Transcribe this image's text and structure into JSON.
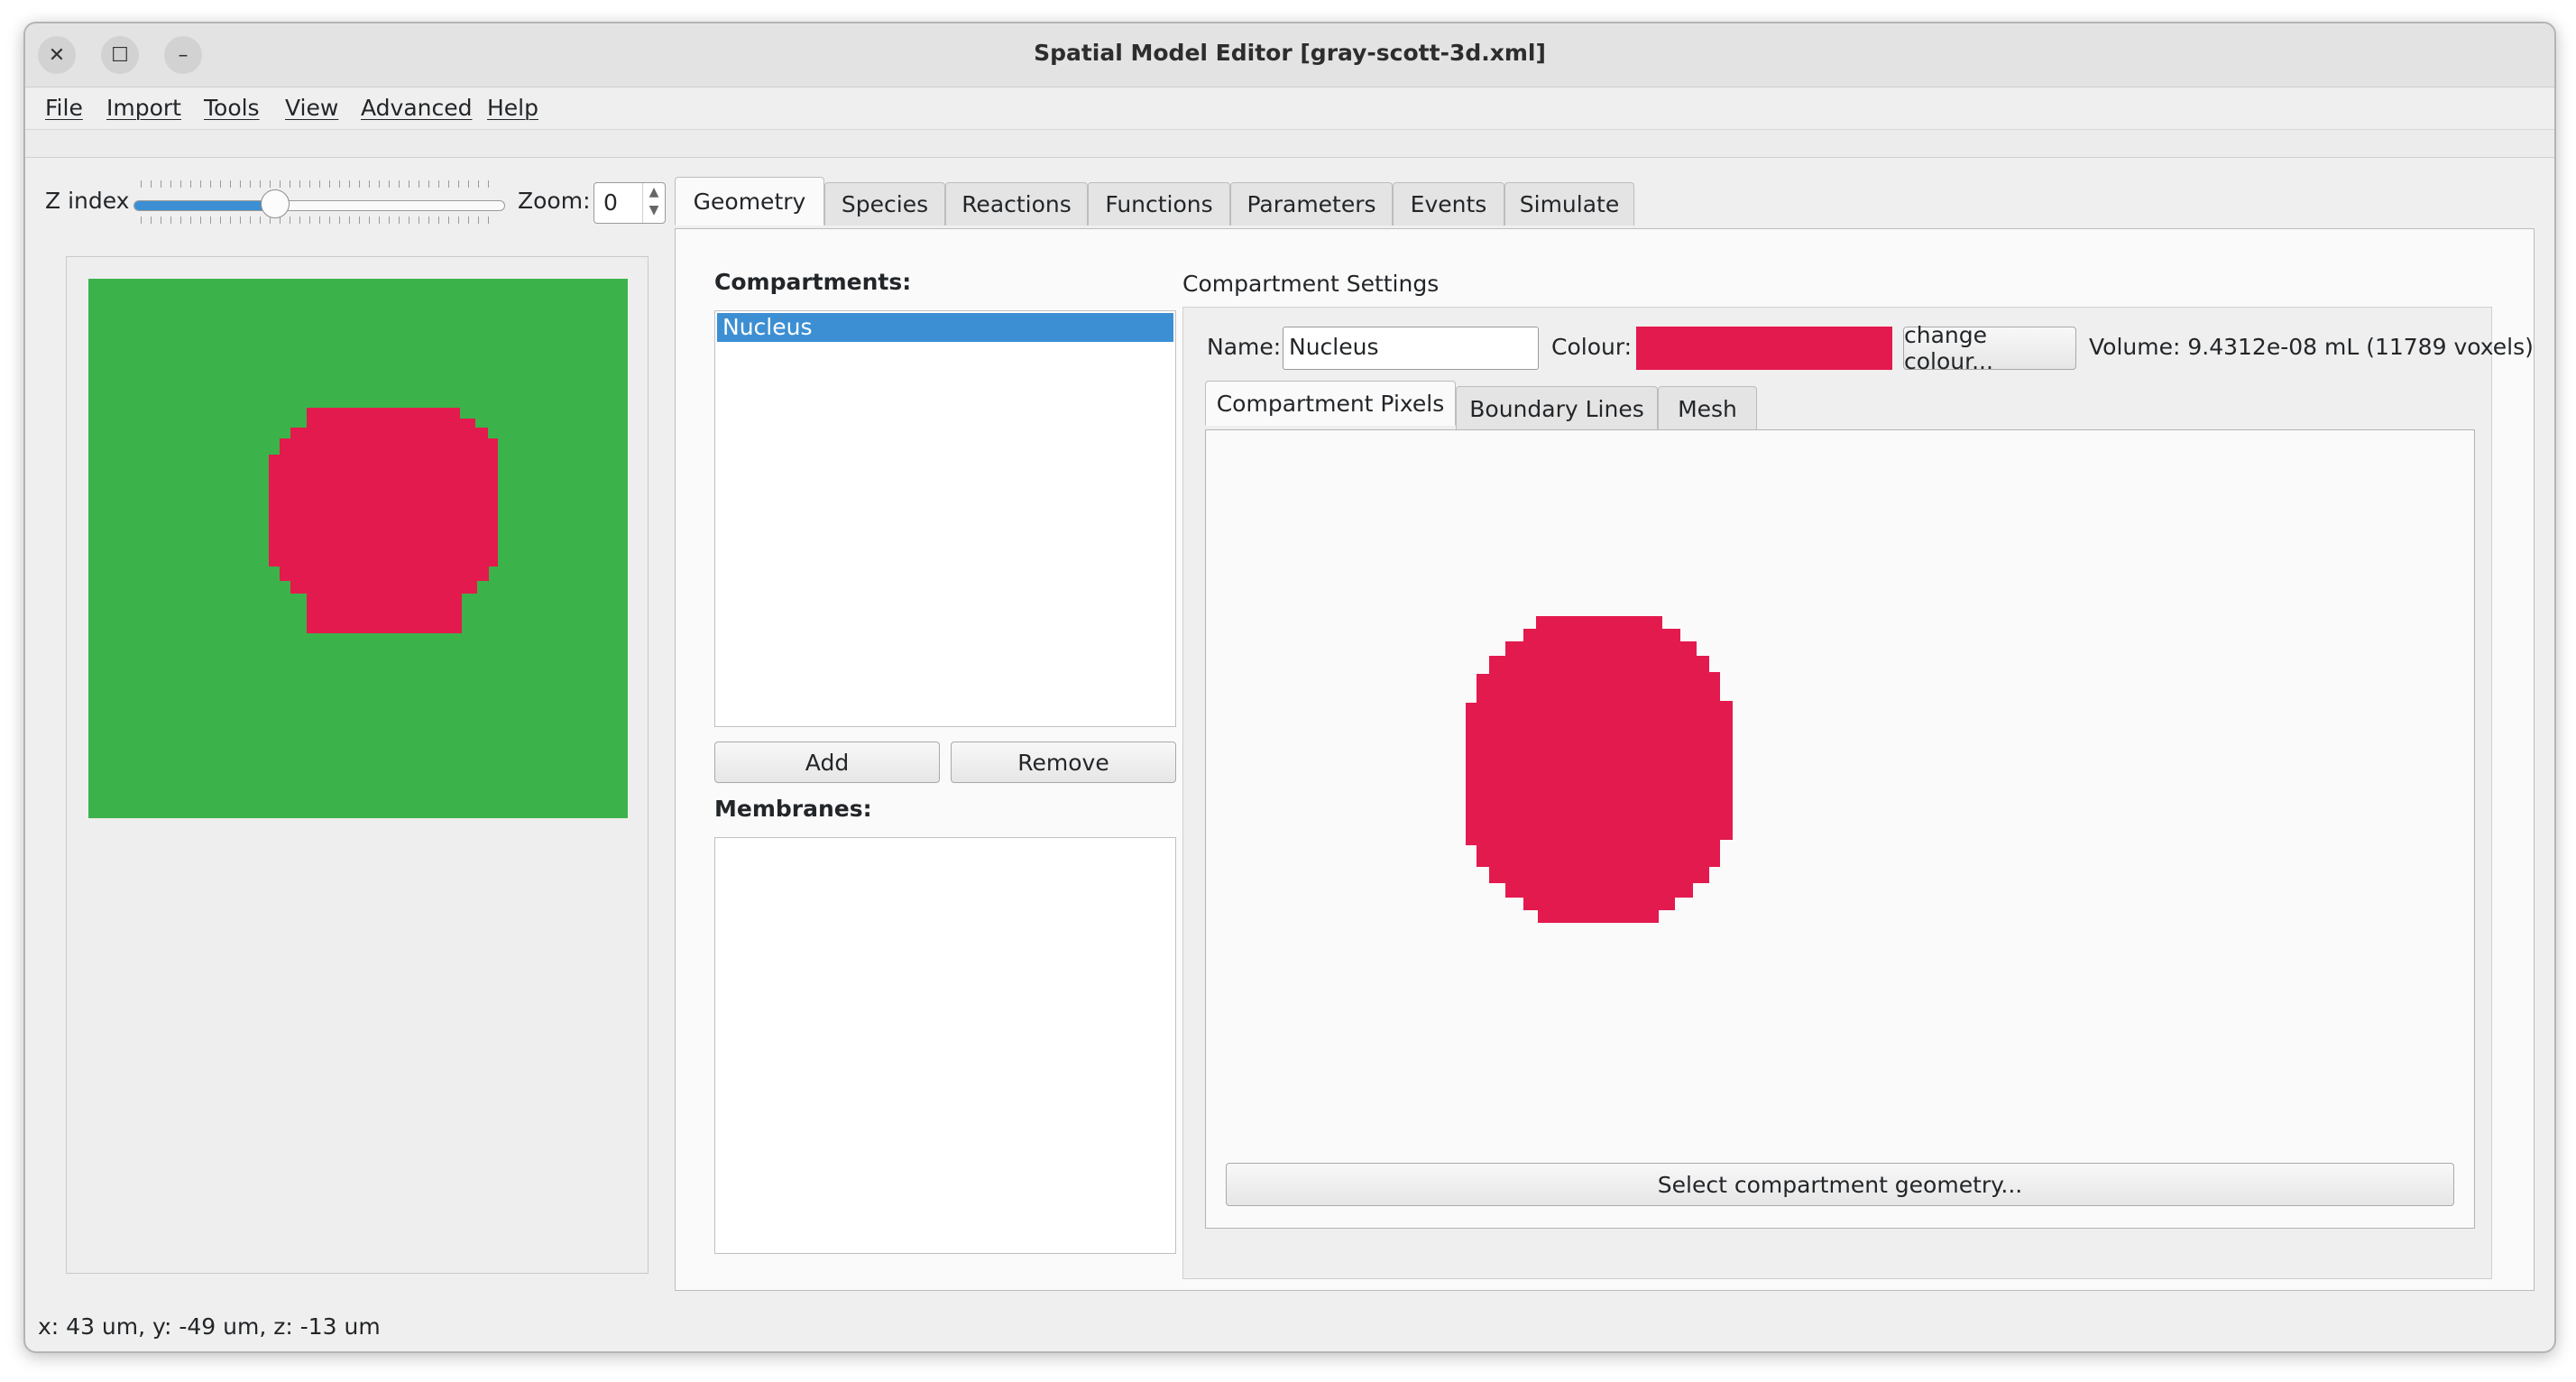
{
  "window": {
    "title": "Spatial Model Editor [gray-scott-3d.xml]",
    "buttons": {
      "close": "✕",
      "maximize": "☐",
      "minimize": "–"
    }
  },
  "menu": {
    "items": [
      "File",
      "Import",
      "Tools",
      "View",
      "Advanced",
      "Help"
    ]
  },
  "controls": {
    "z_index_label": "Z index",
    "z_index_fraction": 0.38,
    "zoom_label": "Zoom:",
    "zoom_value": "0"
  },
  "tabs": [
    "Geometry",
    "Species",
    "Reactions",
    "Functions",
    "Parameters",
    "Events",
    "Simulate"
  ],
  "geometry": {
    "compartments_label": "Compartments:",
    "compartments": [
      "Nucleus"
    ],
    "add_label": "Add",
    "remove_label": "Remove",
    "membranes_label": "Membranes:",
    "settings": {
      "title": "Compartment Settings",
      "name_label": "Name:",
      "name_value": "Nucleus",
      "colour_label": "Colour:",
      "colour": "#e31a4d",
      "change_colour_label": "change colour...",
      "volume_text": "Volume: 9.4312e-08 mL (11789 voxels)"
    },
    "inner_tabs": [
      "Compartment Pixels",
      "Boundary Lines",
      "Mesh"
    ],
    "select_geometry_label": "Select compartment geometry..."
  },
  "colors": {
    "background_compartment": "#3cb24b",
    "nucleus": "#e31a4d",
    "selection": "#3d8fd3"
  },
  "status": {
    "coordinates": "x: 43 um, y: -49 um, z: -13 um"
  }
}
